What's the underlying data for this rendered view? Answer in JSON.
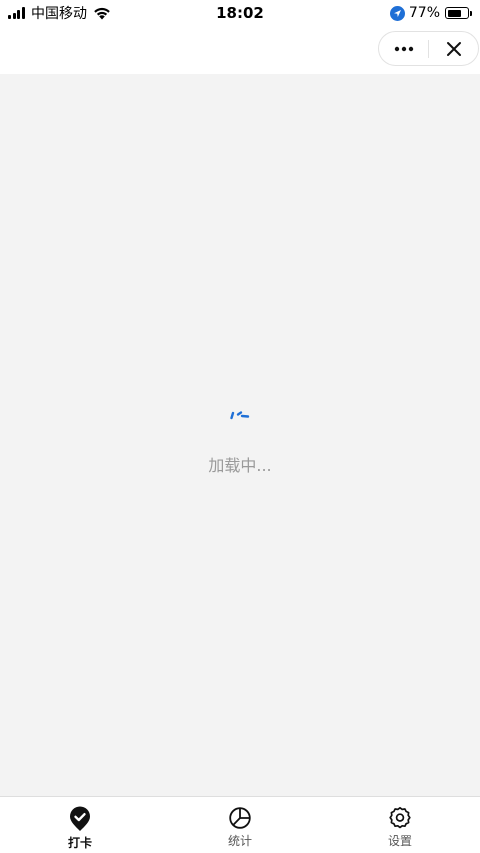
{
  "status_bar": {
    "carrier": "中国移动",
    "time": "18:02",
    "battery_percent": "77%",
    "battery_level": 0.77,
    "icons": [
      "signal-icon",
      "wifi-icon",
      "location-icon",
      "battery-icon"
    ]
  },
  "nav_bar": {
    "more_icon": "more-dots-icon",
    "close_icon": "close-icon"
  },
  "content": {
    "loading_text": "加载中...",
    "spinner_color": "#1f6fd6",
    "background": "#f3f3f3"
  },
  "tab_bar": {
    "tabs": [
      {
        "label": "打卡",
        "icon": "checkin-pin-icon",
        "active": true
      },
      {
        "label": "统计",
        "icon": "pie-chart-icon",
        "active": false
      },
      {
        "label": "设置",
        "icon": "gear-icon",
        "active": false
      }
    ]
  }
}
